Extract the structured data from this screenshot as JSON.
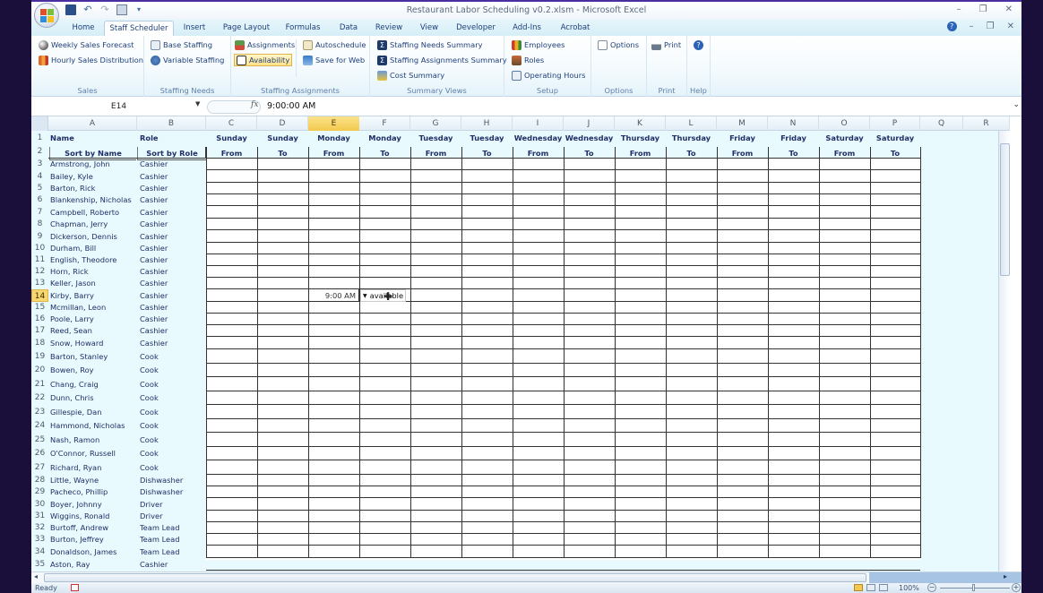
{
  "window": {
    "title": "Restaurant Labor Scheduling v0.2.xlsm - Microsoft Excel",
    "controls": [
      "minimize",
      "restore",
      "close"
    ]
  },
  "quick_access": [
    "save-icon",
    "undo-icon",
    "redo-icon",
    "form-icon",
    "customize-icon"
  ],
  "tabs": [
    {
      "label": "Home",
      "active": false
    },
    {
      "label": "Staff Scheduler",
      "active": true
    },
    {
      "label": "Insert",
      "active": false
    },
    {
      "label": "Page Layout",
      "active": false
    },
    {
      "label": "Formulas",
      "active": false
    },
    {
      "label": "Data",
      "active": false
    },
    {
      "label": "Review",
      "active": false
    },
    {
      "label": "View",
      "active": false
    },
    {
      "label": "Developer",
      "active": false
    },
    {
      "label": "Add-Ins",
      "active": false
    },
    {
      "label": "Acrobat",
      "active": false
    }
  ],
  "ribbon": {
    "groups": [
      {
        "label": "Sales",
        "items": [
          "Weekly Sales Forecast",
          "Hourly Sales Distribution"
        ]
      },
      {
        "label": "Staffing Needs",
        "items": [
          "Base Staffing",
          "Variable Staffing"
        ]
      },
      {
        "label": "Staffing Assignments",
        "items": [
          "Assignments",
          "Availability",
          "Autoschedule",
          "Save for Web"
        ]
      },
      {
        "label": "Summary Views",
        "items": [
          "Staffing Needs Summary",
          "Staffing Assignments Summary",
          "Cost Summary"
        ]
      },
      {
        "label": "Setup",
        "items": [
          "Employees",
          "Roles",
          "Operating Hours"
        ]
      },
      {
        "label": "Options",
        "items": [
          "Options"
        ]
      },
      {
        "label": "Print",
        "items": [
          "Print"
        ]
      },
      {
        "label": "Help",
        "items": [
          ""
        ]
      }
    ],
    "selected_item": "Availability"
  },
  "formula_bar": {
    "name_box": "E14",
    "fx_label": "fx",
    "value": "9:00:00 AM"
  },
  "sheet": {
    "columns": [
      "A",
      "B",
      "C",
      "D",
      "E",
      "F",
      "G",
      "H",
      "I",
      "J",
      "K",
      "L",
      "M",
      "N",
      "O",
      "P",
      "Q",
      "R"
    ],
    "selected_column": "E",
    "selected_row": 14,
    "header_row1": {
      "name": "Name",
      "role": "Role",
      "days": [
        "Sunday",
        "Sunday",
        "Monday",
        "Monday",
        "Tuesday",
        "Tuesday",
        "Wednesday",
        "Wednesday",
        "Thursday",
        "Thursday",
        "Friday",
        "Friday",
        "Saturday",
        "Saturday"
      ]
    },
    "header_row2": {
      "sort_name": "Sort by Name",
      "sort_role": "Sort by Role",
      "subs": [
        "From",
        "To",
        "From",
        "To",
        "From",
        "To",
        "From",
        "To",
        "From",
        "To",
        "From",
        "To",
        "From",
        "To"
      ]
    },
    "rows": [
      {
        "n": 3,
        "name": "Armstrong, John",
        "role": "Cashier"
      },
      {
        "n": 4,
        "name": "Bailey, Kyle",
        "role": "Cashier"
      },
      {
        "n": 5,
        "name": "Barton, Rick",
        "role": "Cashier"
      },
      {
        "n": 6,
        "name": "Blankenship, Nicholas",
        "role": "Cashier"
      },
      {
        "n": 7,
        "name": "Campbell, Roberto",
        "role": "Cashier"
      },
      {
        "n": 8,
        "name": "Chapman, Jerry",
        "role": "Cashier"
      },
      {
        "n": 9,
        "name": "Dickerson, Dennis",
        "role": "Cashier"
      },
      {
        "n": 10,
        "name": "Durham, Bill",
        "role": "Cashier"
      },
      {
        "n": 11,
        "name": "English, Theodore",
        "role": "Cashier"
      },
      {
        "n": 12,
        "name": "Horn, Rick",
        "role": "Cashier"
      },
      {
        "n": 13,
        "name": "Keller, Jason",
        "role": "Cashier"
      },
      {
        "n": 14,
        "name": "Kirby, Barry",
        "role": "Cashier"
      },
      {
        "n": 15,
        "name": "Mcmillan, Leon",
        "role": "Cashier"
      },
      {
        "n": 16,
        "name": "Poole, Larry",
        "role": "Cashier"
      },
      {
        "n": 17,
        "name": "Reed, Sean",
        "role": "Cashier"
      },
      {
        "n": 18,
        "name": "Snow, Howard",
        "role": "Cashier"
      },
      {
        "n": 19,
        "name": "Barton, Stanley",
        "role": "Cook"
      },
      {
        "n": 20,
        "name": "Bowen, Roy",
        "role": "Cook"
      },
      {
        "n": 21,
        "name": "Chang, Craig",
        "role": "Cook"
      },
      {
        "n": 22,
        "name": "Dunn, Chris",
        "role": "Cook"
      },
      {
        "n": 23,
        "name": "Gillespie, Dan",
        "role": "Cook"
      },
      {
        "n": 24,
        "name": "Hammond, Nicholas",
        "role": "Cook"
      },
      {
        "n": 25,
        "name": "Nash, Ramon",
        "role": "Cook"
      },
      {
        "n": 26,
        "name": "O'Connor, Russell",
        "role": "Cook"
      },
      {
        "n": 27,
        "name": "Richard, Ryan",
        "role": "Cook"
      },
      {
        "n": 28,
        "name": "Little, Wayne",
        "role": "Dishwasher"
      },
      {
        "n": 29,
        "name": "Pacheco, Phillip",
        "role": "Dishwasher"
      },
      {
        "n": 30,
        "name": "Boyer, Johnny",
        "role": "Driver"
      },
      {
        "n": 31,
        "name": "Wiggins, Ronald",
        "role": "Driver"
      },
      {
        "n": 32,
        "name": "Burtoff, Andrew",
        "role": "Team Lead"
      },
      {
        "n": 33,
        "name": "Burton, Jeffrey",
        "role": "Team Lead"
      },
      {
        "n": 34,
        "name": "Donaldson, James",
        "role": "Team Lead"
      },
      {
        "n": 35,
        "name": "Aston, Ray",
        "role": "Cashier"
      }
    ],
    "active_cell": {
      "ref": "E14",
      "display": "9:00 AM"
    },
    "dropdown": {
      "value": "available"
    }
  },
  "status": {
    "text": "Ready",
    "zoom": "100%"
  }
}
